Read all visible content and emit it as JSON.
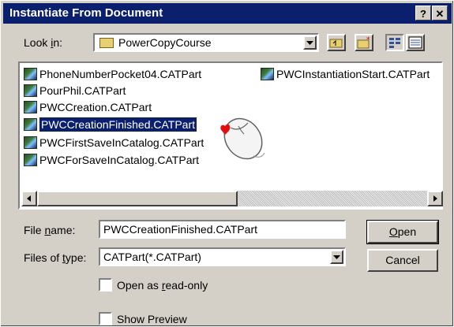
{
  "window": {
    "title": "Instantiate From Document",
    "help_label": "?",
    "close_label": "✕"
  },
  "lookin": {
    "label_pre": "Look ",
    "label_key": "i",
    "label_post": "n:",
    "value": "PowerCopyCourse"
  },
  "files": [
    {
      "name": "PhoneNumberPocket04.CATPart"
    },
    {
      "name": "PourPhil.CATPart"
    },
    {
      "name": "PWCCreation.CATPart"
    },
    {
      "name": "PWCCreationFinished.CATPart"
    },
    {
      "name": "PWCFirstSaveInCatalog.CATPart"
    },
    {
      "name": "PWCForSaveInCatalog.CATPart"
    },
    {
      "name": "PWCInstantiationStart.CATPart"
    }
  ],
  "filename": {
    "label_pre": "File ",
    "label_key": "n",
    "label_post": "ame:",
    "value": "PWCCreationFinished.CATPart"
  },
  "filetype": {
    "label_pre": "Files of ",
    "label_key": "t",
    "label_post": "ype:",
    "value": "CATPart(*.CATPart)"
  },
  "buttons": {
    "open_key": "O",
    "open_rest": "pen",
    "cancel": "Cancel"
  },
  "readonly": {
    "pre": "Open as ",
    "key": "r",
    "post": "ead-only"
  },
  "preview": {
    "label": "Show Preview"
  }
}
